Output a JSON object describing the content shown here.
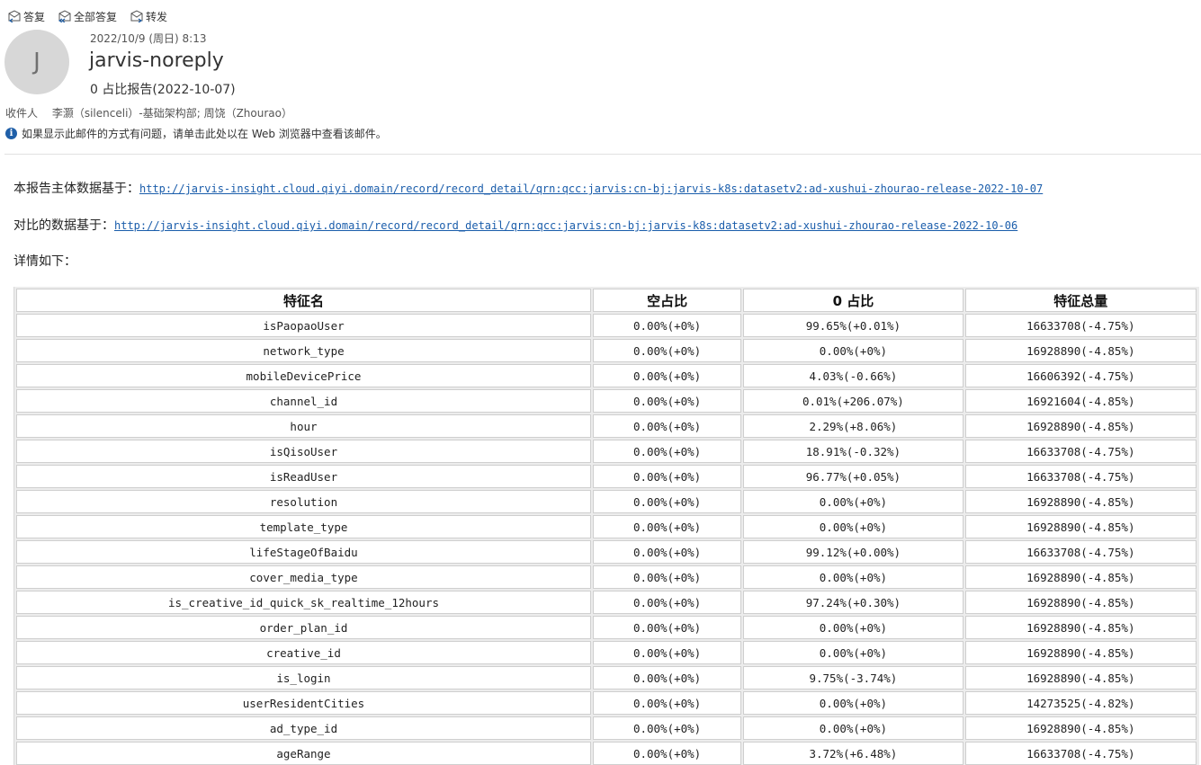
{
  "toolbar": {
    "reply": "答复",
    "reply_all": "全部答复",
    "forward": "转发"
  },
  "message": {
    "avatar_initial": "J",
    "datetime": "2022/10/9 (周日) 8:13",
    "sender": "jarvis-noreply",
    "subject": "0 占比报告(2022-10-07)",
    "recipients_label": "收件人",
    "recipients": "李灏（silenceli）-基础架构部; 周饶（Zhourao）",
    "info_text": "如果显示此邮件的方式有问题，请单击此处以在 Web 浏览器中查看该邮件。"
  },
  "body": {
    "line1_prefix": "本报告主体数据基于：",
    "line1_link": "http://jarvis-insight.cloud.qiyi.domain/record/record_detail/qrn:qcc:jarvis:cn-bj:jarvis-k8s:datasetv2:ad-xushui-zhourao-release-2022-10-07",
    "line2_prefix": "对比的数据基于：",
    "line2_link": "http://jarvis-insight.cloud.qiyi.domain/record/record_detail/qrn:qcc:jarvis:cn-bj:jarvis-k8s:datasetv2:ad-xushui-zhourao-release-2022-10-06",
    "line3": "详情如下："
  },
  "table": {
    "headers": [
      "特征名",
      "空占比",
      "0 占比",
      "特征总量"
    ],
    "rows": [
      [
        "isPaopaoUser",
        "0.00%(+0%)",
        "99.65%(+0.01%)",
        "16633708(-4.75%)"
      ],
      [
        "network_type",
        "0.00%(+0%)",
        "0.00%(+0%)",
        "16928890(-4.85%)"
      ],
      [
        "mobileDevicePrice",
        "0.00%(+0%)",
        "4.03%(-0.66%)",
        "16606392(-4.75%)"
      ],
      [
        "channel_id",
        "0.00%(+0%)",
        "0.01%(+206.07%)",
        "16921604(-4.85%)"
      ],
      [
        "hour",
        "0.00%(+0%)",
        "2.29%(+8.06%)",
        "16928890(-4.85%)"
      ],
      [
        "isQisoUser",
        "0.00%(+0%)",
        "18.91%(-0.32%)",
        "16633708(-4.75%)"
      ],
      [
        "isReadUser",
        "0.00%(+0%)",
        "96.77%(+0.05%)",
        "16633708(-4.75%)"
      ],
      [
        "resolution",
        "0.00%(+0%)",
        "0.00%(+0%)",
        "16928890(-4.85%)"
      ],
      [
        "template_type",
        "0.00%(+0%)",
        "0.00%(+0%)",
        "16928890(-4.85%)"
      ],
      [
        "lifeStageOfBaidu",
        "0.00%(+0%)",
        "99.12%(+0.00%)",
        "16633708(-4.75%)"
      ],
      [
        "cover_media_type",
        "0.00%(+0%)",
        "0.00%(+0%)",
        "16928890(-4.85%)"
      ],
      [
        "is_creative_id_quick_sk_realtime_12hours",
        "0.00%(+0%)",
        "97.24%(+0.30%)",
        "16928890(-4.85%)"
      ],
      [
        "order_plan_id",
        "0.00%(+0%)",
        "0.00%(+0%)",
        "16928890(-4.85%)"
      ],
      [
        "creative_id",
        "0.00%(+0%)",
        "0.00%(+0%)",
        "16928890(-4.85%)"
      ],
      [
        "is_login",
        "0.00%(+0%)",
        "9.75%(-3.74%)",
        "16928890(-4.85%)"
      ],
      [
        "userResidentCities",
        "0.00%(+0%)",
        "0.00%(+0%)",
        "14273525(-4.82%)"
      ],
      [
        "ad_type_id",
        "0.00%(+0%)",
        "0.00%(+0%)",
        "16928890(-4.85%)"
      ],
      [
        "ageRange",
        "0.00%(+0%)",
        "3.72%(+6.48%)",
        "16633708(-4.75%)"
      ]
    ]
  },
  "colors": {
    "link": "#1a5dab",
    "avatar_bg": "#d7d7d7",
    "info_icon": "#1f5fa8"
  }
}
